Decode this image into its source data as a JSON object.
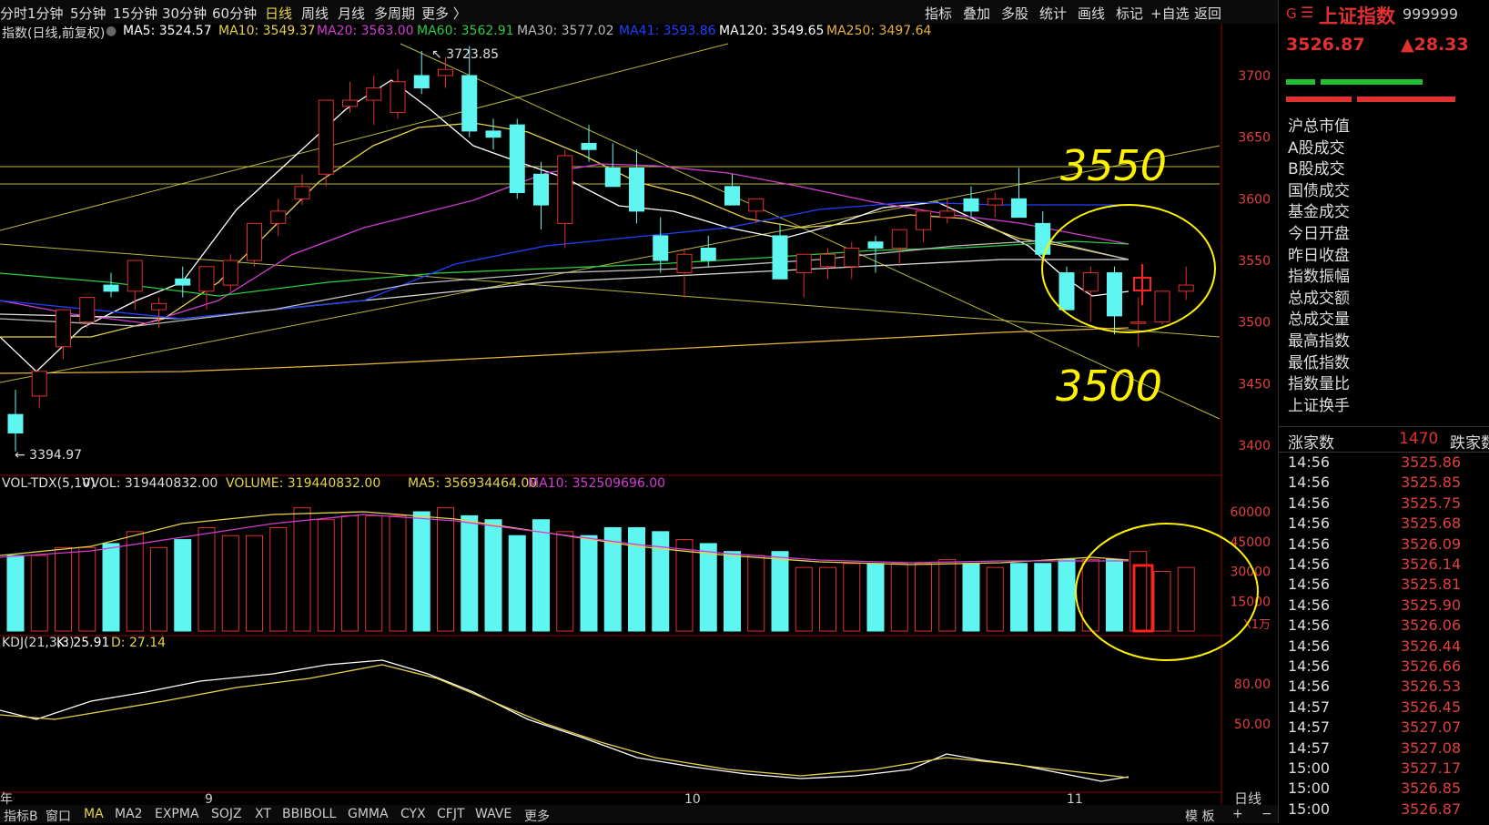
{
  "toolbar": {
    "periods": [
      "分时",
      "1分钟",
      "5分钟",
      "15分钟",
      "30分钟",
      "60分钟",
      "日线",
      "周线",
      "月线",
      "多周期",
      "更多 〉"
    ],
    "active_period": "日线",
    "actions": [
      "指标",
      "叠加",
      "多股",
      "统计",
      "画线",
      "标记",
      "+自选",
      "返回"
    ]
  },
  "ma_line": {
    "title": "指数(日线,前复权)",
    "items": [
      {
        "label": "MA5: 3524.57",
        "color": "#ffffff"
      },
      {
        "label": "MA10: 3549.37",
        "color": "#e6d34a"
      },
      {
        "label": "MA20: 3563.00",
        "color": "#d23cd2"
      },
      {
        "label": "MA60: 3562.91",
        "color": "#2ecc40"
      },
      {
        "label": "MA30: 3577.02",
        "color": "#bbbbbb"
      },
      {
        "label": "MA41: 3593.86",
        "color": "#2040ff"
      },
      {
        "label": "MA120: 3549.65",
        "color": "#ffffff"
      },
      {
        "label": "MA250: 3497.64",
        "color": "#e6b43c"
      }
    ]
  },
  "price_chart": {
    "high_label": "3723.85",
    "low_label": "3394.97",
    "y_ticks": [
      "3700",
      "3650",
      "3600",
      "3550",
      "3500",
      "3450",
      "3400"
    ],
    "annotation_top": "3550",
    "annotation_bottom": "3500"
  },
  "volume_panel": {
    "title": "VOL-TDX(5,10)",
    "items": [
      {
        "label": "VVOL: 319440832.00",
        "color": "#dddddd"
      },
      {
        "label": "VOLUME: 319440832.00",
        "color": "#e6d34a"
      },
      {
        "label": "MA5: 356934464.00",
        "color": "#e6d34a"
      },
      {
        "label": "MA10: 352509696.00",
        "color": "#d23cd2"
      }
    ],
    "y_ticks": [
      "60000",
      "45000",
      "30000",
      "15000"
    ],
    "unit": "X1万"
  },
  "kdj_panel": {
    "title": "KDJ(21,3,3)",
    "items": [
      {
        "label": "K: 25.91",
        "color": "#ffffff"
      },
      {
        "label": "D: 27.14",
        "color": "#e6d34a"
      }
    ],
    "y_ticks": [
      "80.00",
      "50.00"
    ]
  },
  "x_axis": {
    "labels": [
      "年",
      "9",
      "10",
      "11"
    ],
    "period_label": "日线"
  },
  "bottom_tabs": [
    "指标B",
    "窗口",
    "MA",
    "MA2",
    "EXPMA",
    "SOJZ",
    "XT",
    "BBIBOLL",
    "GMMA",
    "CYX",
    "CFJT",
    "WAVE",
    "更多"
  ],
  "bottom_right": [
    "模 板",
    "+",
    "−"
  ],
  "quote_panel": {
    "name": "上证指数",
    "code": "999999",
    "price": "3526.87",
    "change": "▲28.33",
    "rows": [
      "沪总市值",
      "A股成交",
      "B股成交",
      "国债成交",
      "基金成交",
      "今日开盘",
      "昨日收盘",
      "指数振幅",
      "总成交额",
      "总成交量",
      "最高指数",
      "最低指数",
      "指数量比",
      "上证换手"
    ],
    "rise_label": "涨家数",
    "rise_count": "1470",
    "fall_label": "跌家数"
  },
  "ticks": [
    {
      "time": "14:56",
      "price": "3525.86"
    },
    {
      "time": "14:56",
      "price": "3525.85"
    },
    {
      "time": "14:56",
      "price": "3525.75"
    },
    {
      "time": "14:56",
      "price": "3525.68"
    },
    {
      "time": "14:56",
      "price": "3526.09"
    },
    {
      "time": "14:56",
      "price": "3526.14"
    },
    {
      "time": "14:56",
      "price": "3525.81"
    },
    {
      "time": "14:56",
      "price": "3525.90"
    },
    {
      "time": "14:56",
      "price": "3526.06"
    },
    {
      "time": "14:56",
      "price": "3526.44"
    },
    {
      "time": "14:56",
      "price": "3526.66"
    },
    {
      "time": "14:56",
      "price": "3526.53"
    },
    {
      "time": "14:57",
      "price": "3526.45"
    },
    {
      "time": "14:57",
      "price": "3527.07"
    },
    {
      "time": "14:57",
      "price": "3527.08"
    },
    {
      "time": "15:00",
      "price": "3527.17"
    },
    {
      "time": "15:00",
      "price": "3526.85"
    },
    {
      "time": "15:00",
      "price": "3526.87"
    }
  ],
  "candles": [
    [
      3425,
      3445,
      3395,
      3410
    ],
    [
      3440,
      3455,
      3430,
      3460
    ],
    [
      3480,
      3485,
      3470,
      3510
    ],
    [
      3500,
      3515,
      3495,
      3520
    ],
    [
      3530,
      3540,
      3520,
      3525
    ],
    [
      3525,
      3540,
      3510,
      3550
    ],
    [
      3510,
      3520,
      3495,
      3515
    ],
    [
      3535,
      3545,
      3520,
      3530
    ],
    [
      3525,
      3540,
      3510,
      3545
    ],
    [
      3530,
      3555,
      3525,
      3550
    ],
    [
      3550,
      3580,
      3545,
      3580
    ],
    [
      3580,
      3600,
      3570,
      3590
    ],
    [
      3600,
      3620,
      3595,
      3610
    ],
    [
      3620,
      3650,
      3610,
      3680
    ],
    [
      3675,
      3695,
      3670,
      3680
    ],
    [
      3680,
      3700,
      3660,
      3690
    ],
    [
      3670,
      3705,
      3665,
      3695
    ],
    [
      3700,
      3720,
      3685,
      3690
    ],
    [
      3700,
      3715,
      3690,
      3705
    ],
    [
      3700,
      3724,
      3650,
      3655
    ],
    [
      3655,
      3665,
      3640,
      3650
    ],
    [
      3660,
      3665,
      3600,
      3605
    ],
    [
      3620,
      3630,
      3575,
      3595
    ],
    [
      3580,
      3640,
      3560,
      3635
    ],
    [
      3645,
      3660,
      3630,
      3640
    ],
    [
      3625,
      3645,
      3610,
      3610
    ],
    [
      3625,
      3640,
      3580,
      3590
    ],
    [
      3570,
      3585,
      3540,
      3550
    ],
    [
      3540,
      3560,
      3520,
      3555
    ],
    [
      3560,
      3570,
      3545,
      3550
    ],
    [
      3610,
      3620,
      3595,
      3595
    ],
    [
      3590,
      3600,
      3580,
      3600
    ],
    [
      3570,
      3580,
      3540,
      3535
    ],
    [
      3540,
      3555,
      3520,
      3555
    ],
    [
      3545,
      3560,
      3535,
      3555
    ],
    [
      3545,
      3565,
      3535,
      3560
    ],
    [
      3565,
      3570,
      3540,
      3560
    ],
    [
      3560,
      3575,
      3545,
      3575
    ],
    [
      3575,
      3590,
      3565,
      3590
    ],
    [
      3585,
      3600,
      3580,
      3590
    ],
    [
      3600,
      3610,
      3585,
      3590
    ],
    [
      3595,
      3605,
      3585,
      3600
    ],
    [
      3600,
      3625,
      3595,
      3585
    ],
    [
      3580,
      3590,
      3550,
      3555
    ],
    [
      3540,
      3545,
      3510,
      3510
    ],
    [
      3525,
      3545,
      3500,
      3540
    ],
    [
      3540,
      3545,
      3490,
      3505
    ],
    [
      3500,
      3520,
      3480,
      3500
    ],
    [
      3500,
      3520,
      3498,
      3525
    ],
    [
      3525,
      3545,
      3518,
      3530
    ]
  ],
  "candle_colors": {
    "up": "#e03030",
    "down": "#5ff5f0"
  },
  "chart_colors": {
    "grid": "#8a0000",
    "yellow": "#e6e64a",
    "annotation": "#fff200",
    "highlight": "#ff2020"
  }
}
